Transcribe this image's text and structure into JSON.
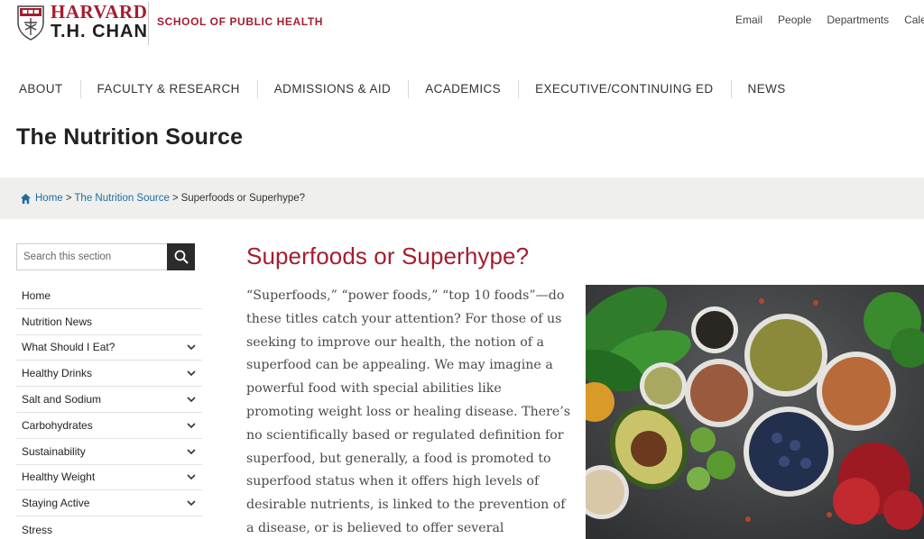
{
  "header": {
    "logo_line1": "HARVARD",
    "logo_line2": "T.H. CHAN",
    "school": "SCHOOL OF PUBLIC HEALTH",
    "utility_links": [
      "Email",
      "People",
      "Departments",
      "Cale"
    ]
  },
  "main_nav": [
    "ABOUT",
    "FACULTY & RESEARCH",
    "ADMISSIONS & AID",
    "ACADEMICS",
    "EXECUTIVE/CONTINUING ED",
    "NEWS"
  ],
  "site_title": "The Nutrition Source",
  "breadcrumb": {
    "home": "Home",
    "sep": ">",
    "section": "The Nutrition Source",
    "current": "Superfoods or Superhype?"
  },
  "search": {
    "placeholder": "Search this section"
  },
  "sidebar": {
    "items": [
      {
        "label": "Home",
        "expandable": false
      },
      {
        "label": "Nutrition News",
        "expandable": false
      },
      {
        "label": "What Should I Eat?",
        "expandable": true
      },
      {
        "label": "Healthy Drinks",
        "expandable": true
      },
      {
        "label": "Salt and Sodium",
        "expandable": true
      },
      {
        "label": "Carbohydrates",
        "expandable": true
      },
      {
        "label": "Sustainability",
        "expandable": true
      },
      {
        "label": "Healthy Weight",
        "expandable": true
      },
      {
        "label": "Staying Active",
        "expandable": true
      },
      {
        "label": "Stress",
        "expandable": false
      }
    ]
  },
  "article": {
    "title": "Superfoods or Superhype?",
    "body": "“Superfoods,” “power foods,” “top 10 foods”—do these titles catch your attention? For those of us seeking to improve our health, the notion of a superfood can be appealing. We may imagine a powerful food with special abilities like promoting weight loss or healing disease. There’s no scientifically based or regulated definition for superfood, but generally, a food is promoted to superfood status when it offers high levels of desirable nutrients, is linked to the prevention of a disease, or is believed to offer several"
  },
  "colors": {
    "brand_crimson": "#a51c30",
    "link_blue": "#1f6e9e",
    "breadcrumb_bg": "#efefed",
    "search_button": "#2b2b2b"
  }
}
